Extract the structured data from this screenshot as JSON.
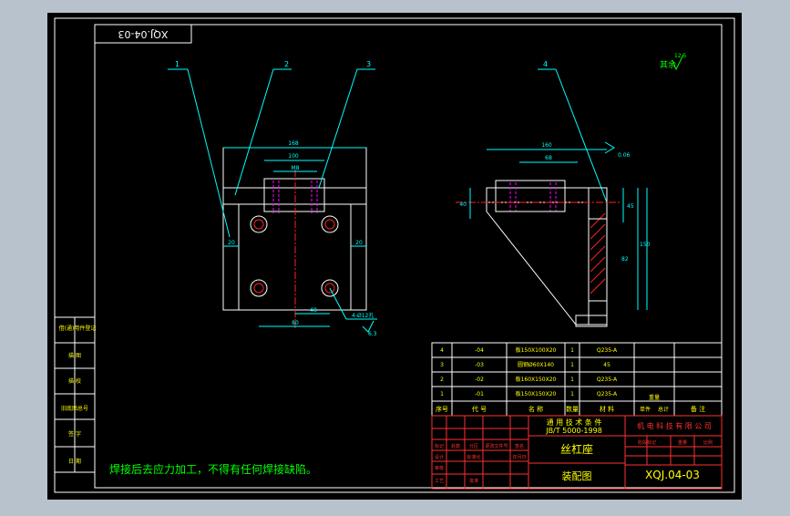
{
  "drawing": {
    "code_stamp": "XQJ.04-03",
    "note": "焊接后去应力加工，不得有任何焊接缺陷。",
    "roughness_note": "其余",
    "roughness_value": "12.5",
    "colors": {
      "background": "#000000",
      "border": "#ffffff",
      "outline": "#ffffff",
      "dimension": "#00ffff",
      "centerline": "#ff2020",
      "hidden": "#ff00ff",
      "note": "#00ff00",
      "title_grid": "#ff3030",
      "title_text": "#ffff00"
    }
  },
  "callouts": [
    "1",
    "2",
    "3",
    "4"
  ],
  "front_view": {
    "dims": {
      "overall_width": "168",
      "hidden_width": "M8",
      "slot_width": "100",
      "left_side": "20",
      "right_side": "20",
      "bottom_width": "80",
      "hole_spacing": "48",
      "hole_note": "4-Ø12孔",
      "thread_note": "6.3"
    }
  },
  "side_view": {
    "dims": {
      "top_width": "160",
      "inner_width": "68",
      "left_height": "40",
      "right_height_1": "45",
      "right_height_2": "150",
      "right_height_3": "82",
      "chamfer": "0.06"
    }
  },
  "left_strip": {
    "labels": [
      "借(通)用件登记",
      "描 图",
      "描 校",
      "旧底图总号",
      "签 字",
      "日 期"
    ]
  },
  "bom": {
    "rows": [
      {
        "seq": "4",
        "code": "-04",
        "name": "板150X100X20",
        "qty": "1",
        "material": "Q235-A"
      },
      {
        "seq": "3",
        "code": "-03",
        "name": "圆钢Ø60X140",
        "qty": "1",
        "material": "45"
      },
      {
        "seq": "2",
        "code": "-02",
        "name": "板160X150X20",
        "qty": "1",
        "material": "Q235-A"
      },
      {
        "seq": "1",
        "code": "-01",
        "name": "板150X150X20",
        "qty": "1",
        "material": "Q235-A"
      }
    ],
    "headers": [
      "序号",
      "代 号",
      "名 称",
      "数量",
      "材 料",
      "单件",
      "总计",
      "备 注"
    ],
    "mass_label": "重量"
  },
  "title_block": {
    "standard_1": "通 用 技 术 条 件",
    "standard_2": "JB/T 5000-1998",
    "company": "机 电 科 技 有 限 公 司",
    "part_name": "丝杠座",
    "drawing_type": "装配图",
    "drawing_code": "XQJ.04-03",
    "cells": [
      "标记",
      "处数",
      "分区",
      "更改文件号",
      "签名",
      "年月日",
      "设计",
      "标准化",
      "审核",
      "工艺",
      "批准"
    ],
    "right_cells": [
      "阶段标记",
      "重量",
      "比例"
    ]
  }
}
